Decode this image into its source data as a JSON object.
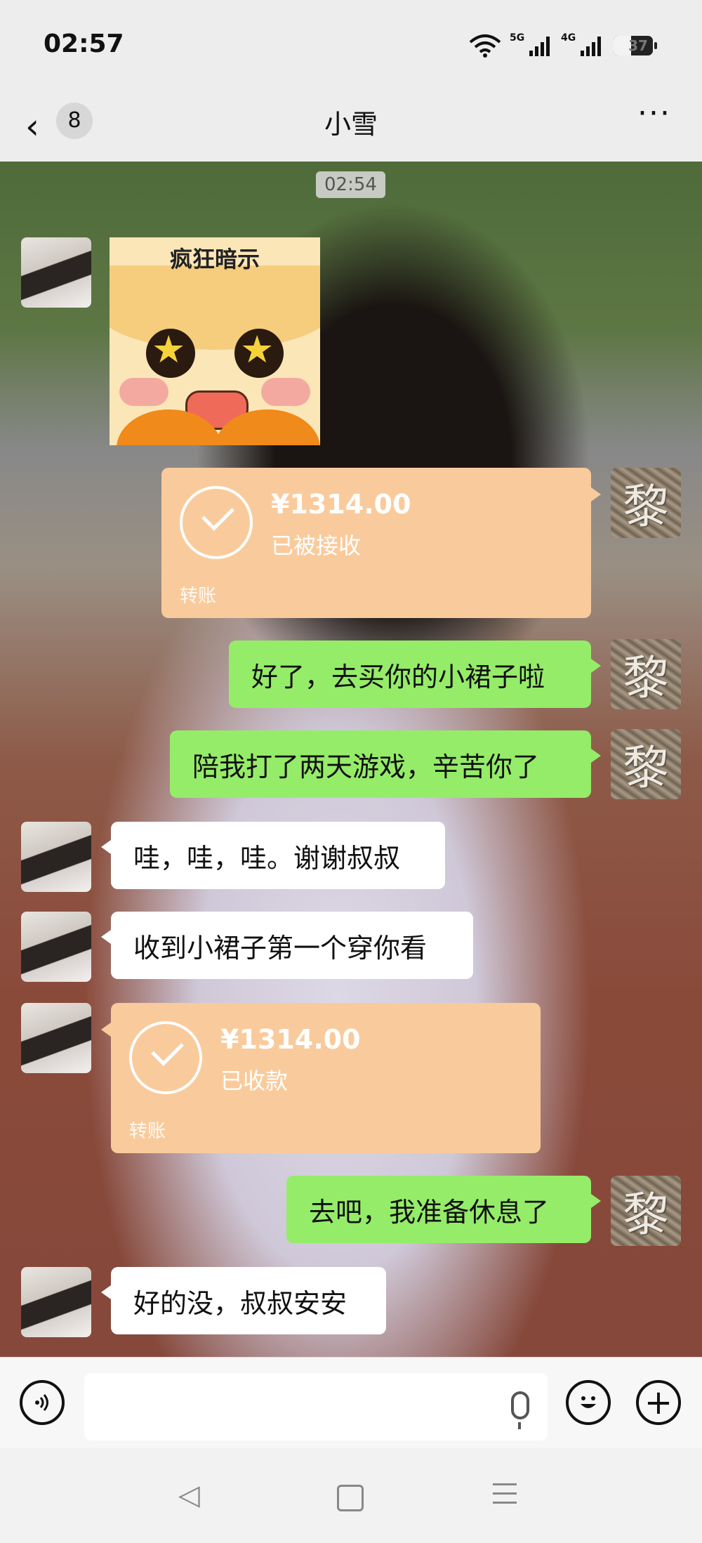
{
  "status_bar": {
    "time": "02:57",
    "network_1": "5G",
    "network_2": "4G",
    "battery": "37"
  },
  "header": {
    "back_icon": "chevron-left-icon",
    "unread_count": "8",
    "title": "小雪",
    "more_icon": "more-horizontal-icon"
  },
  "chat": {
    "timestamp": "02:54",
    "sticker_caption": "疯狂暗示",
    "transfer_sent": {
      "amount": "¥1314.00",
      "status": "已被接收",
      "label": "转账"
    },
    "msg_1": "好了，去买你的小裙子啦",
    "msg_2": "陪我打了两天游戏，辛苦你了",
    "msg_3": "哇，哇，哇。谢谢叔叔",
    "msg_4": "收到小裙子第一个穿你看",
    "transfer_received": {
      "amount": "¥1314.00",
      "status": "已收款",
      "label": "转账"
    },
    "msg_5": "去吧，我准备休息了",
    "msg_6": "好的没，叔叔安安",
    "my_avatar_glyph": "黎",
    "colors": {
      "green_bubble": "#95ec69",
      "transfer_bubble": "#f9cb9c",
      "white_bubble": "#ffffff"
    }
  },
  "input_bar": {
    "voice_icon": "voice-input-icon",
    "mic_icon": "microphone-icon",
    "emoji_icon": "emoji-icon",
    "plus_icon": "plus-icon"
  },
  "nav": {
    "back": "◁"
  }
}
